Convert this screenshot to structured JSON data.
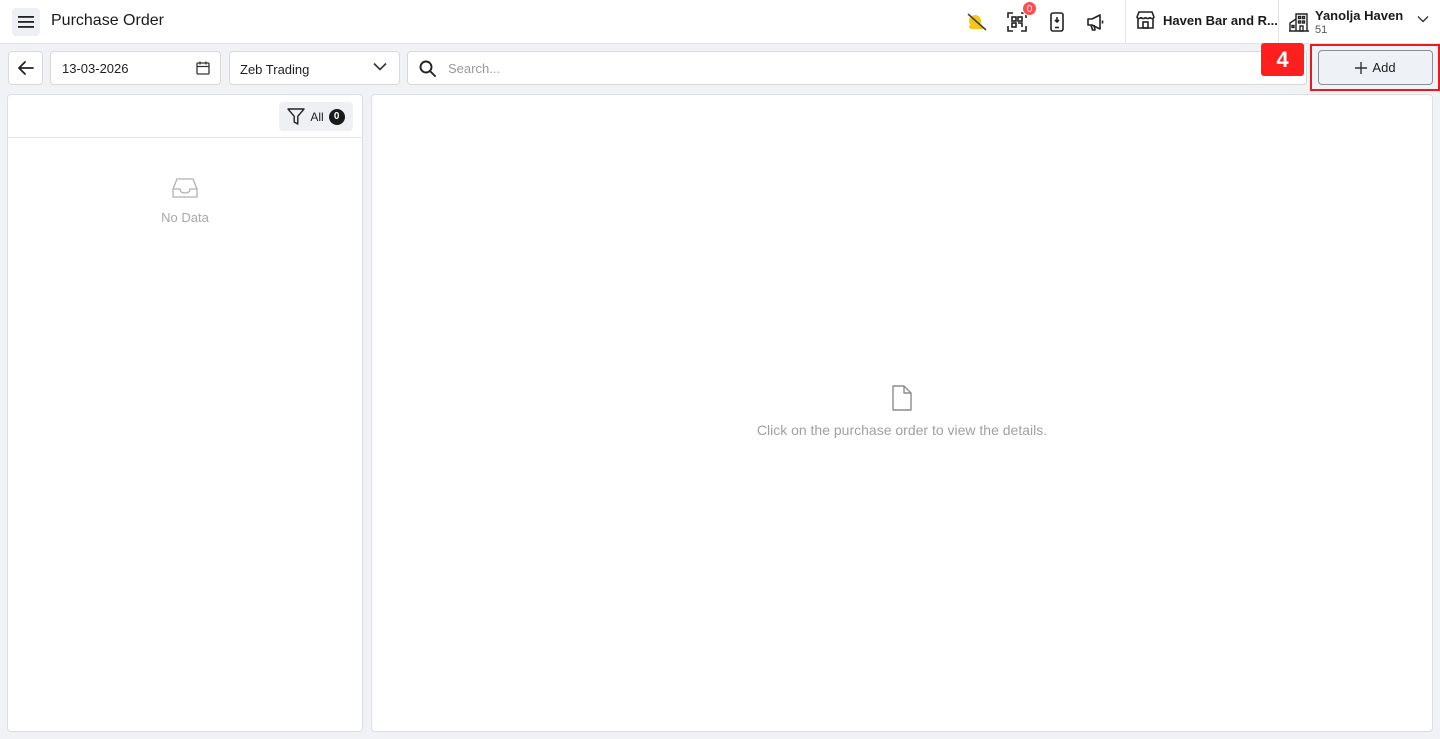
{
  "header": {
    "title": "Purchase Order",
    "notification_count": "0",
    "store_name": "Haven Bar and R...",
    "org_name": "Yanolja Haven",
    "org_sub": "51"
  },
  "toolbar": {
    "date_value": "13-03-2026",
    "supplier_value": "Zeb Trading",
    "search_placeholder": "Search...",
    "add_label": "Add",
    "step_marker": "4"
  },
  "list_panel": {
    "filter_label": "All",
    "filter_count": "0",
    "empty_text": "No Data"
  },
  "detail_panel": {
    "empty_text": "Click on the purchase order to view the details."
  },
  "colors": {
    "accent_highlight": "#e51b23",
    "badge_red": "#ff4d4f",
    "weather_yellow": "#f5c518"
  },
  "icons": [
    "menu-icon",
    "weather-icon",
    "qr-scan-icon",
    "mobile-icon",
    "megaphone-icon",
    "store-icon",
    "building-icon",
    "chevron-down-icon",
    "arrow-left-icon",
    "calendar-icon",
    "search-icon",
    "plus-icon",
    "filter-icon",
    "inbox-icon",
    "file-icon"
  ]
}
